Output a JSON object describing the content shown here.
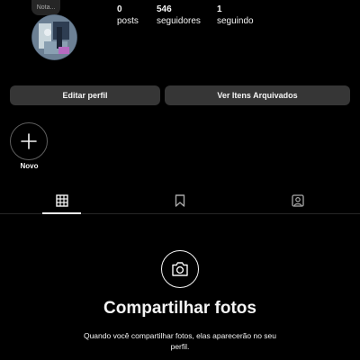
{
  "profile": {
    "note_placeholder": "Nota...",
    "stats": [
      {
        "value": "0",
        "label": "posts"
      },
      {
        "value": "546",
        "label": "seguidores"
      },
      {
        "value": "1",
        "label": "seguindo"
      }
    ]
  },
  "actions": {
    "edit_label": "Editar perfil",
    "archived_label": "Ver Itens Arquivados"
  },
  "highlights": {
    "new_label": "Novo",
    "new_icon": "plus-icon"
  },
  "tabs": [
    {
      "icon": "grid-icon",
      "active": true
    },
    {
      "icon": "bookmark-icon",
      "active": false
    },
    {
      "icon": "tagged-user-icon",
      "active": false
    }
  ],
  "empty_state": {
    "icon": "camera-icon",
    "title": "Compartilhar fotos",
    "subtitle": "Quando você compartilhar fotos, elas aparecerão no seu perfil."
  },
  "colors": {
    "background": "#000000",
    "button": "#363636",
    "text": "#f5f5f5",
    "muted": "#a8a8a8"
  }
}
